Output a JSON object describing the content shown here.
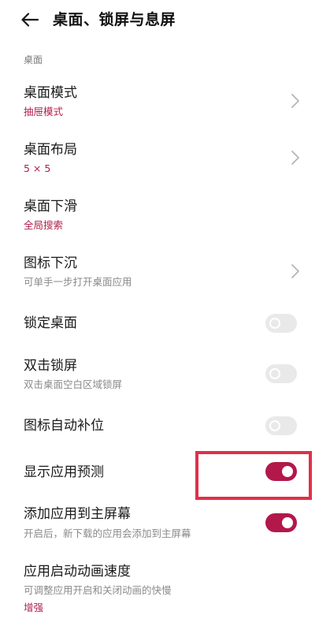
{
  "header": {
    "back_icon": "arrow-left-icon",
    "title": "桌面、锁屏与息屏"
  },
  "section": {
    "label": "桌面"
  },
  "colors": {
    "accent": "#b3184a",
    "highlight": "#e0304a",
    "toggle_off": "#e9e9e9"
  },
  "items": [
    {
      "title": "桌面模式",
      "value": "抽屉模式",
      "control": "chevron"
    },
    {
      "title": "桌面布局",
      "value": "5 × 5",
      "control": "chevron"
    },
    {
      "title": "桌面下滑",
      "value": "全局搜索",
      "control": "none"
    },
    {
      "title": "图标下沉",
      "desc": "可单手一步打开桌面应用",
      "control": "chevron"
    },
    {
      "title": "锁定桌面",
      "control": "toggle",
      "state": "off"
    },
    {
      "title": "双击锁屏",
      "desc": "双击桌面空白区域锁屏",
      "control": "toggle",
      "state": "off"
    },
    {
      "title": "图标自动补位",
      "control": "toggle",
      "state": "off"
    },
    {
      "title": "显示应用预测",
      "control": "toggle",
      "state": "on"
    },
    {
      "title": "添加应用到主屏幕",
      "desc": "开启后，新下载的应用会添加到主屏幕",
      "control": "toggle",
      "state": "on"
    },
    {
      "title": "应用启动动画速度",
      "desc": "可调整应用开启和关闭动画的快慢",
      "value": "增强",
      "control": "none"
    }
  ]
}
